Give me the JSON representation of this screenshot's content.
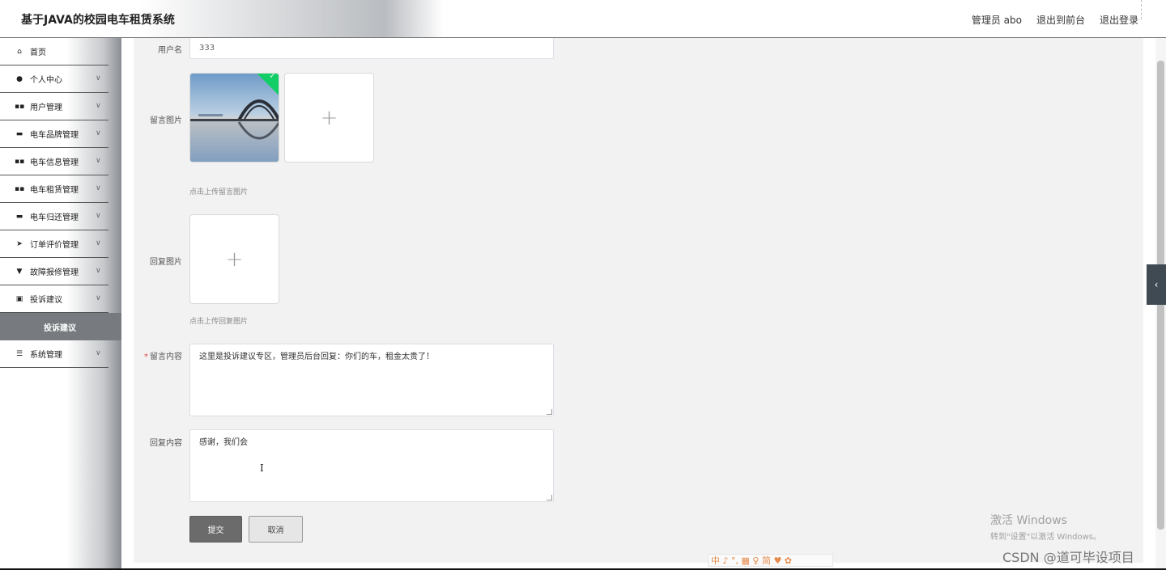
{
  "header": {
    "title": "基于JAVA的校园电车租赁系统",
    "user": "管理员 abo",
    "to_front": "退出到前台",
    "logout": "退出登录"
  },
  "sidebar": {
    "items": [
      {
        "label": "首页",
        "icon": "home-icon",
        "glyph": "⌂",
        "chevron": ""
      },
      {
        "label": "个人中心",
        "icon": "user-icon",
        "glyph": "●",
        "chevron": "∨"
      },
      {
        "label": "用户管理",
        "icon": "grid-icon",
        "glyph": "▪▪",
        "chevron": "∨"
      },
      {
        "label": "电车品牌管理",
        "icon": "briefcase-icon",
        "glyph": "▬",
        "chevron": "∨"
      },
      {
        "label": "电车信息管理",
        "icon": "grid-icon",
        "glyph": "▪▪",
        "chevron": "∨"
      },
      {
        "label": "电车租赁管理",
        "icon": "grid-icon",
        "glyph": "▪▪",
        "chevron": "∨"
      },
      {
        "label": "电车归还管理",
        "icon": "bus-icon",
        "glyph": "▬",
        "chevron": "∨"
      },
      {
        "label": "订单评价管理",
        "icon": "send-icon",
        "glyph": "➤",
        "chevron": "∨"
      },
      {
        "label": "故障报修管理",
        "icon": "trophy-icon",
        "glyph": "▼",
        "chevron": "∨"
      },
      {
        "label": "投诉建议",
        "icon": "clipboard-icon",
        "glyph": "▣",
        "chevron": "∨"
      }
    ],
    "active_sub": "投诉建议",
    "last_item": {
      "label": "系统管理",
      "icon": "list-icon",
      "glyph": "☰",
      "chevron": "∨"
    }
  },
  "form": {
    "username_label": "用户名",
    "username_value": "333",
    "message_image_label": "留言图片",
    "message_image_hint": "点击上传留言图片",
    "reply_image_label": "回复图片",
    "reply_image_hint": "点击上传回复图片",
    "message_content_label": "留言内容",
    "message_content_value": "这里是投诉建议专区，管理员后台回复：你们的车，租金太贵了！",
    "reply_content_label": "回复内容",
    "reply_content_value": "感谢，我们会",
    "plus": "+",
    "check": "✓"
  },
  "buttons": {
    "submit": "提交",
    "cancel": "取消"
  },
  "watermarks": {
    "windows_line1": "激活 Windows",
    "windows_line2": "转到\"设置\"以激活 Windows。",
    "csdn": "CSDN @道可毕设项目",
    "ime": "中 ♪ °, ▦ ♀ 简 ♥ ✿"
  },
  "side_toggle": "‹",
  "colors": {
    "sub_active_bg": "#777b80",
    "submit_bg": "#6b6b6b",
    "panel_bg": "#f2f2f2",
    "success_check": "#13ce66"
  }
}
